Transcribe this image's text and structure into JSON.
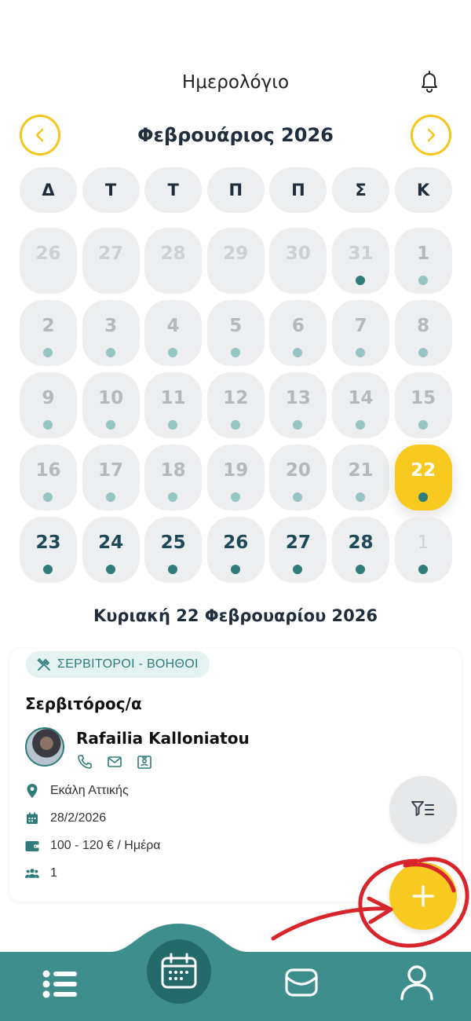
{
  "header": {
    "title": "Ημερολόγιο",
    "bell_icon": "bell-icon"
  },
  "calendar": {
    "month_label": "Φεβρουάριος 2026",
    "prev_icon": "chevron-left-icon",
    "next_icon": "chevron-right-icon",
    "accent_color": "#f8c91f",
    "weekdays": [
      "Δ",
      "Τ",
      "Τ",
      "Π",
      "Π",
      "Σ",
      "Κ"
    ],
    "days": [
      {
        "label": "26",
        "state": "muted",
        "dot": "none"
      },
      {
        "label": "27",
        "state": "muted",
        "dot": "none"
      },
      {
        "label": "28",
        "state": "muted",
        "dot": "none"
      },
      {
        "label": "29",
        "state": "muted",
        "dot": "none"
      },
      {
        "label": "30",
        "state": "muted",
        "dot": "none"
      },
      {
        "label": "31",
        "state": "muted",
        "dot": "dark"
      },
      {
        "label": "1",
        "state": "past",
        "dot": "light"
      },
      {
        "label": "2",
        "state": "past",
        "dot": "light"
      },
      {
        "label": "3",
        "state": "past",
        "dot": "light"
      },
      {
        "label": "4",
        "state": "past",
        "dot": "light"
      },
      {
        "label": "5",
        "state": "past",
        "dot": "light"
      },
      {
        "label": "6",
        "state": "past",
        "dot": "light"
      },
      {
        "label": "7",
        "state": "past",
        "dot": "light"
      },
      {
        "label": "8",
        "state": "past",
        "dot": "light"
      },
      {
        "label": "9",
        "state": "past",
        "dot": "light"
      },
      {
        "label": "10",
        "state": "past",
        "dot": "light"
      },
      {
        "label": "11",
        "state": "past",
        "dot": "light"
      },
      {
        "label": "12",
        "state": "past",
        "dot": "light"
      },
      {
        "label": "13",
        "state": "past",
        "dot": "light"
      },
      {
        "label": "14",
        "state": "past",
        "dot": "light"
      },
      {
        "label": "15",
        "state": "past",
        "dot": "light"
      },
      {
        "label": "16",
        "state": "past",
        "dot": "light"
      },
      {
        "label": "17",
        "state": "past",
        "dot": "light"
      },
      {
        "label": "18",
        "state": "past",
        "dot": "light"
      },
      {
        "label": "19",
        "state": "past",
        "dot": "light"
      },
      {
        "label": "20",
        "state": "past",
        "dot": "light"
      },
      {
        "label": "21",
        "state": "past",
        "dot": "light"
      },
      {
        "label": "22",
        "state": "selected",
        "dot": "dark"
      },
      {
        "label": "23",
        "state": "future",
        "dot": "dark"
      },
      {
        "label": "24",
        "state": "future",
        "dot": "dark"
      },
      {
        "label": "25",
        "state": "future",
        "dot": "dark"
      },
      {
        "label": "26",
        "state": "future",
        "dot": "dark"
      },
      {
        "label": "27",
        "state": "future",
        "dot": "dark"
      },
      {
        "label": "28",
        "state": "future",
        "dot": "dark"
      },
      {
        "label": "1",
        "state": "next-month",
        "dot": "dark"
      }
    ]
  },
  "selected_date": "Κυριακή 22 Φεβρουαρίου 2026",
  "job_card": {
    "category_icon": "utensils-icon",
    "category": "ΣΕΡΒΙΤΟΡΟΙ - ΒΟΗΘΟΙ",
    "title": "Σερβιτόρος/α",
    "person_name": "Rafailia Kalloniatou",
    "contact_icons": [
      "phone-icon",
      "mail-icon",
      "id-card-icon"
    ],
    "location": "Εκάλη Αττικής",
    "date": "28/2/2026",
    "pay": "100 - 120 € / Ημέρα",
    "positions": "1"
  },
  "fabs": {
    "filter_icon": "filter-icon",
    "add_icon": "plus-icon"
  },
  "bottom_nav": {
    "color": "#3e8f8c",
    "items": [
      "list-icon",
      "calendar-icon",
      "mail-icon",
      "user-icon"
    ]
  }
}
